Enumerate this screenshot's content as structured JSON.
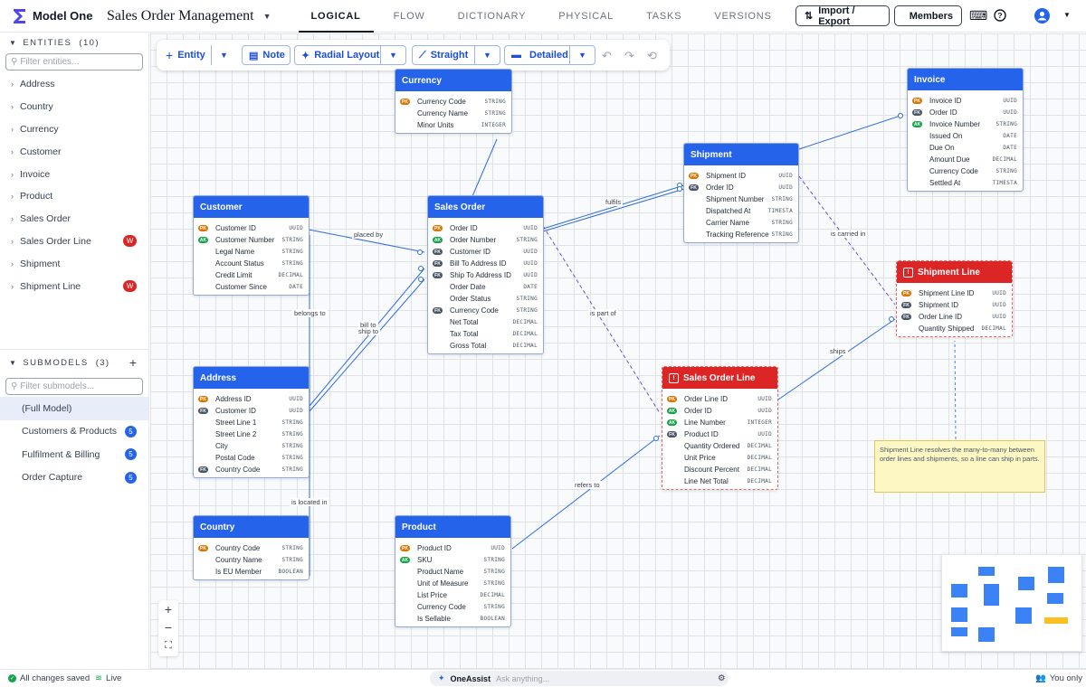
{
  "app": {
    "name": "Model One",
    "model_name": "Sales Order Management"
  },
  "nav": {
    "tabs": [
      "LOGICAL",
      "FLOW",
      "DICTIONARY",
      "PHYSICAL",
      "TASKS",
      "VERSIONS"
    ]
  },
  "header": {
    "import_export": "Import / Export",
    "members": "Members"
  },
  "sidebar": {
    "entities_heading": "ENTITIES",
    "entities_count": "(10)",
    "entities_filter_placeholder": "Filter entities...",
    "entities": [
      {
        "name": "Address"
      },
      {
        "name": "Country"
      },
      {
        "name": "Currency"
      },
      {
        "name": "Customer"
      },
      {
        "name": "Invoice"
      },
      {
        "name": "Product"
      },
      {
        "name": "Sales Order"
      },
      {
        "name": "Sales Order Line",
        "badge": "W"
      },
      {
        "name": "Shipment"
      },
      {
        "name": "Shipment Line",
        "badge": "W"
      }
    ],
    "submodels_heading": "SUBMODELS",
    "submodels_count": "(3)",
    "add_symbol": "+",
    "submodels_filter_placeholder": "Filter submodels...",
    "submodels": [
      {
        "name": "(Full Model)"
      },
      {
        "name": "Customers & Products",
        "count": "5"
      },
      {
        "name": "Fulfilment & Billing",
        "count": "5"
      },
      {
        "name": "Order Capture",
        "count": "5"
      }
    ]
  },
  "toolbar": {
    "entity": "Entity",
    "note": "Note",
    "layout": "Radial Layout",
    "line_style": "Straight",
    "detail": "Detailed"
  },
  "entities": [
    {
      "title": "Currency",
      "attrs": [
        {
          "key": "PK",
          "name": "Currency Code",
          "type": "STRING"
        },
        {
          "key": "",
          "name": "Currency Name",
          "type": "STRING"
        },
        {
          "key": "",
          "name": "Minor Units",
          "type": "INTEGER"
        }
      ]
    },
    {
      "title": "Invoice",
      "attrs": [
        {
          "key": "PK",
          "name": "Invoice ID",
          "type": "UUID"
        },
        {
          "key": "FK",
          "name": "Order ID",
          "type": "UUID"
        },
        {
          "key": "AK",
          "name": "Invoice Number",
          "type": "STRING"
        },
        {
          "key": "",
          "name": "Issued On",
          "type": "DATE"
        },
        {
          "key": "",
          "name": "Due On",
          "type": "DATE"
        },
        {
          "key": "",
          "name": "Amount Due",
          "type": "DECIMAL"
        },
        {
          "key": "",
          "name": "Currency Code",
          "type": "STRING"
        },
        {
          "key": "",
          "name": "Settled At",
          "type": "TIMESTA"
        }
      ]
    },
    {
      "title": "Shipment",
      "attrs": [
        {
          "key": "PK",
          "name": "Shipment ID",
          "type": "UUID"
        },
        {
          "key": "FK",
          "name": "Order ID",
          "type": "UUID"
        },
        {
          "key": "",
          "name": "Shipment Number",
          "type": "STRING"
        },
        {
          "key": "",
          "name": "Dispatched At",
          "type": "TIMESTA"
        },
        {
          "key": "",
          "name": "Carrier Name",
          "type": "STRING"
        },
        {
          "key": "",
          "name": "Tracking Reference",
          "type": "STRING"
        }
      ]
    },
    {
      "title": "Customer",
      "attrs": [
        {
          "key": "PK",
          "name": "Customer ID",
          "type": "UUID"
        },
        {
          "key": "AK",
          "name": "Customer Number",
          "type": "STRING"
        },
        {
          "key": "",
          "name": "Legal Name",
          "type": "STRING"
        },
        {
          "key": "",
          "name": "Account Status",
          "type": "STRING"
        },
        {
          "key": "",
          "name": "Credit Limit",
          "type": "DECIMAL"
        },
        {
          "key": "",
          "name": "Customer Since",
          "type": "DATE"
        }
      ]
    },
    {
      "title": "Sales Order",
      "attrs": [
        {
          "key": "PK",
          "name": "Order ID",
          "type": "UUID"
        },
        {
          "key": "AK",
          "name": "Order Number",
          "type": "STRING"
        },
        {
          "key": "FK",
          "name": "Customer ID",
          "type": "UUID"
        },
        {
          "key": "FK",
          "name": "Bill To Address ID",
          "type": "UUID"
        },
        {
          "key": "FK",
          "name": "Ship To Address ID",
          "type": "UUID"
        },
        {
          "key": "",
          "name": "Order Date",
          "type": "DATE"
        },
        {
          "key": "",
          "name": "Order Status",
          "type": "STRING"
        },
        {
          "key": "FK",
          "name": "Currency Code",
          "type": "STRING"
        },
        {
          "key": "",
          "name": "Net Total",
          "type": "DECIMAL"
        },
        {
          "key": "",
          "name": "Tax Total",
          "type": "DECIMAL"
        },
        {
          "key": "",
          "name": "Gross Total",
          "type": "DECIMAL"
        }
      ]
    },
    {
      "title": "Shipment Line",
      "warning": true,
      "attrs": [
        {
          "key": "PK",
          "name": "Shipment Line ID",
          "type": "UUID"
        },
        {
          "key": "FK",
          "name": "Shipment ID",
          "type": "UUID"
        },
        {
          "key": "FK",
          "name": "Order Line ID",
          "type": "UUID"
        },
        {
          "key": "",
          "name": "Quantity Shipped",
          "type": "DECIMAL"
        }
      ]
    },
    {
      "title": "Address",
      "attrs": [
        {
          "key": "PK",
          "name": "Address ID",
          "type": "UUID"
        },
        {
          "key": "FK",
          "name": "Customer ID",
          "type": "UUID"
        },
        {
          "key": "",
          "name": "Street Line 1",
          "type": "STRING"
        },
        {
          "key": "",
          "name": "Street Line 2",
          "type": "STRING"
        },
        {
          "key": "",
          "name": "City",
          "type": "STRING"
        },
        {
          "key": "",
          "name": "Postal Code",
          "type": "STRING"
        },
        {
          "key": "FK",
          "name": "Country Code",
          "type": "STRING"
        }
      ]
    },
    {
      "title": "Sales Order Line",
      "warning": true,
      "attrs": [
        {
          "key": "PK",
          "name": "Order Line ID",
          "type": "UUID"
        },
        {
          "key": "AK",
          "name": "Order ID",
          "type": "UUID"
        },
        {
          "key": "AK",
          "name": "Line Number",
          "type": "INTEGER"
        },
        {
          "key": "FK",
          "name": "Product ID",
          "type": "UUID"
        },
        {
          "key": "",
          "name": "Quantity Ordered",
          "type": "DECIMAL"
        },
        {
          "key": "",
          "name": "Unit Price",
          "type": "DECIMAL"
        },
        {
          "key": "",
          "name": "Discount Percent",
          "type": "DECIMAL"
        },
        {
          "key": "",
          "name": "Line Net Total",
          "type": "DECIMAL"
        }
      ]
    },
    {
      "title": "Country",
      "attrs": [
        {
          "key": "PK",
          "name": "Country Code",
          "type": "STRING"
        },
        {
          "key": "",
          "name": "Country Name",
          "type": "STRING"
        },
        {
          "key": "",
          "name": "Is EU Member",
          "type": "BOOLEAN"
        }
      ]
    },
    {
      "title": "Product",
      "attrs": [
        {
          "key": "PK",
          "name": "Product ID",
          "type": "UUID"
        },
        {
          "key": "AK",
          "name": "SKU",
          "type": "STRING"
        },
        {
          "key": "",
          "name": "Product Name",
          "type": "STRING"
        },
        {
          "key": "",
          "name": "Unit of Measure",
          "type": "STRING"
        },
        {
          "key": "",
          "name": "List Price",
          "type": "DECIMAL"
        },
        {
          "key": "",
          "name": "Currency Code",
          "type": "STRING"
        },
        {
          "key": "",
          "name": "Is Sellable",
          "type": "BOOLEAN"
        }
      ]
    }
  ],
  "relationships": {
    "placed_by": "placed by",
    "fulfils": "fulfils",
    "belongs_to": "belongs to",
    "bill_to": "bill to",
    "ship_to": "ship to",
    "is_part_of": "is part of",
    "is_carried_in": "is carried in",
    "ships": "ships",
    "is_located_in": "is located in",
    "refers_to": "refers to"
  },
  "note": {
    "text": "Shipment Line resolves the many-to-many between order lines and shipments, so a line can ship in parts."
  },
  "footer": {
    "saved": "All changes saved",
    "live": "Live",
    "assistant": "OneAssist",
    "assistant_placeholder": "Ask anything...",
    "presence": "You only"
  },
  "colors": {
    "accent": "#2563eb",
    "warning": "#dc2626",
    "pk": "#d97706",
    "fk": "#4b5563",
    "ak": "#16a34a",
    "note": "#fdf7c4"
  },
  "icons": [
    "logo-icon",
    "chevron-down-icon",
    "import-export-icon",
    "members-icon",
    "keyboard-icon",
    "help-icon",
    "avatar-icon",
    "search-icon",
    "plus-icon",
    "note-icon",
    "wand-icon",
    "line-icon",
    "detail-icon",
    "undo-icon",
    "redo-icon",
    "history-icon",
    "zoom-in-icon",
    "zoom-out-icon",
    "fit-icon",
    "check-icon",
    "wifi-icon",
    "sparkle-icon",
    "gear-icon",
    "users-icon"
  ]
}
